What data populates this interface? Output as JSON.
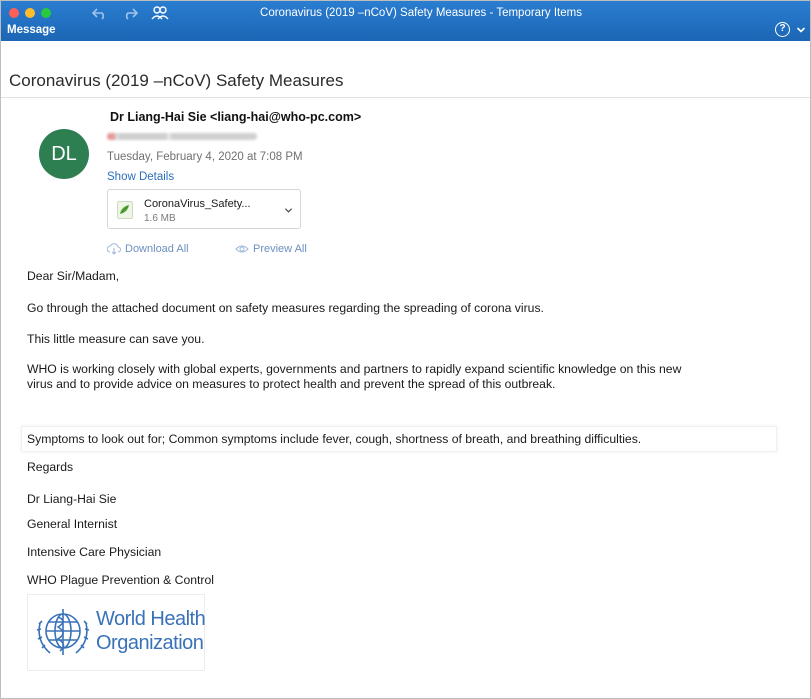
{
  "window": {
    "title": "Coronavirus (2019 –nCoV) Safety Measures - Temporary Items",
    "tab": "Message",
    "help_symbol": "?"
  },
  "message": {
    "subject": "Coronavirus (2019 –nCoV) Safety Measures",
    "avatar_initials": "DL",
    "sender": "Dr Liang-Hai Sie <liang-hai@who-pc.com>",
    "date": "Tuesday, February 4, 2020 at 7:08 PM",
    "show_details": "Show Details"
  },
  "attachment": {
    "name": "CoronaVirus_Safety...",
    "size": "1.6 MB",
    "download_all": "Download All",
    "preview_all": "Preview All"
  },
  "body": {
    "greeting": "Dear Sir/Madam,",
    "p1": "Go through the attached document on safety measures regarding the spreading of corona virus.",
    "p2": "This little measure can save you.",
    "p3_line1": "WHO is working closely with global experts, governments and partners to rapidly expand scientific knowledge on this new",
    "p3_line2": "virus and to provide advice on measures to protect health and prevent the spread of this outbreak.",
    "p4": "Symptoms to look out for; Common symptoms include fever, cough, shortness of breath, and breathing difficulties."
  },
  "signature": {
    "regards": "Regards",
    "name": "Dr Liang-Hai Sie",
    "title1": "General Internist",
    "title2": "Intensive Care Physician",
    "org": "WHO Plague Prevention & Control",
    "logo_line1": "World Health",
    "logo_line2": "Organization"
  },
  "colors": {
    "titlebar": "#1f6fc0",
    "avatar": "#2d7f52",
    "link": "#2a6ebd",
    "logo_blue": "#3a72b8"
  }
}
